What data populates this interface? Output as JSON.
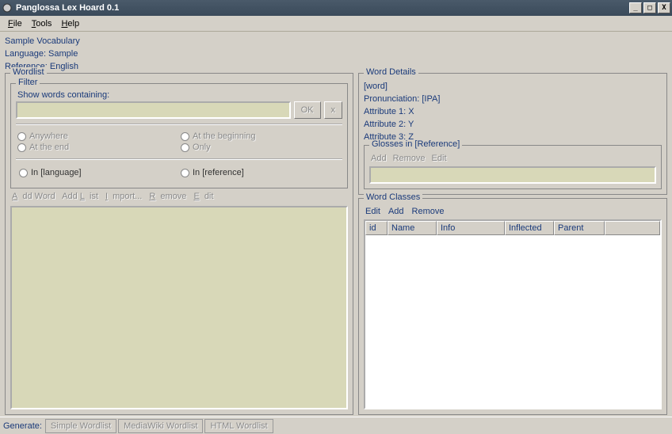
{
  "app": {
    "title": "Panglossa Lex Hoard 0.1"
  },
  "menu": {
    "file": "File",
    "tools": "Tools",
    "help": "Help"
  },
  "info": {
    "vocab": "Sample Vocabulary",
    "language": "Language: Sample",
    "reference": "Reference: English"
  },
  "wordlist": {
    "legend": "Wordlist",
    "filter_legend": "Filter",
    "show_words_label": "Show words containing:",
    "ok": "OK",
    "x": "x",
    "radios": {
      "anywhere": "Anywhere",
      "at_beginning": "At the beginning",
      "at_end": "At the end",
      "only": "Only"
    },
    "lang_radio": "In [language]",
    "ref_radio": "In [reference]",
    "actions": {
      "add_word": "Add Word",
      "add_list": "Add List",
      "import": "Import...",
      "remove": "Remove",
      "edit": "Edit"
    }
  },
  "details": {
    "legend": "Word Details",
    "word": "[word]",
    "pron": "Pronunciation: [IPA]",
    "attr1": "Attribute 1: X",
    "attr2": "Attribute 2: Y",
    "attr3": "Attribute 3: Z"
  },
  "glosses": {
    "legend": "Glosses in [Reference]",
    "add": "Add",
    "remove": "Remove",
    "edit": "Edit"
  },
  "word_classes": {
    "legend": "Word Classes",
    "edit": "Edit",
    "add": "Add",
    "remove": "Remove",
    "cols": {
      "id": "id",
      "name": "Name",
      "info": "Info",
      "inflected": "Inflected",
      "parent": "Parent"
    }
  },
  "status": {
    "generate": "Generate:",
    "simple": "Simple Wordlist",
    "mediawiki": "MediaWiki Wordlist",
    "html": "HTML Wordlist"
  }
}
